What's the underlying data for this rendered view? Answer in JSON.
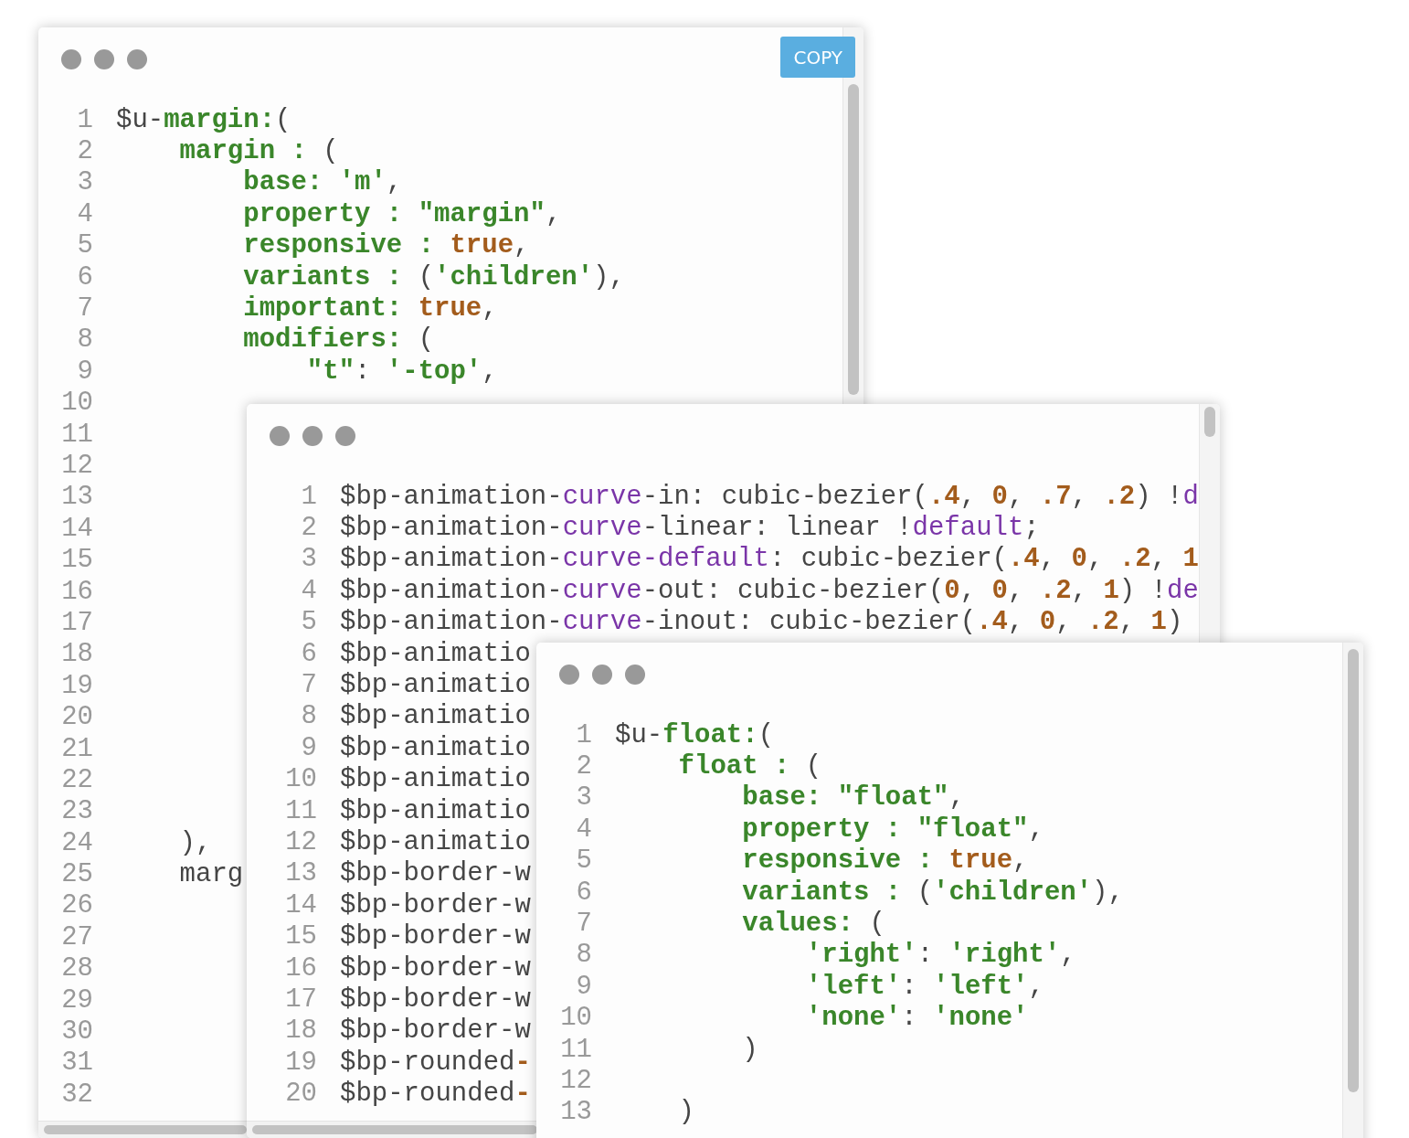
{
  "windows": [
    {
      "copy_button": "COPY",
      "lines": [
        {
          "n": "1",
          "tokens": [
            {
              "t": "$u-",
              "kind": "plain"
            },
            {
              "t": "margin:",
              "kind": "green"
            },
            {
              "t": "(",
              "kind": "plain"
            }
          ]
        },
        {
          "n": "2",
          "tokens": [
            {
              "t": "    margin :",
              "kind": "green"
            },
            {
              "t": " (",
              "kind": "plain"
            }
          ]
        },
        {
          "n": "3",
          "tokens": [
            {
              "t": "        base: 'm'",
              "kind": "green"
            },
            {
              "t": ",",
              "kind": "plain"
            }
          ]
        },
        {
          "n": "4",
          "tokens": [
            {
              "t": "        property : \"margin\"",
              "kind": "green"
            },
            {
              "t": ",",
              "kind": "plain"
            }
          ]
        },
        {
          "n": "5",
          "tokens": [
            {
              "t": "        responsive : ",
              "kind": "green"
            },
            {
              "t": "true",
              "kind": "orange"
            },
            {
              "t": ",",
              "kind": "plain"
            }
          ]
        },
        {
          "n": "6",
          "tokens": [
            {
              "t": "        variants : ",
              "kind": "green"
            },
            {
              "t": "(",
              "kind": "plain"
            },
            {
              "t": "'children'",
              "kind": "green"
            },
            {
              "t": "),",
              "kind": "plain"
            }
          ]
        },
        {
          "n": "7",
          "tokens": [
            {
              "t": "        important: ",
              "kind": "green"
            },
            {
              "t": "true",
              "kind": "orange"
            },
            {
              "t": ",",
              "kind": "plain"
            }
          ]
        },
        {
          "n": "8",
          "tokens": [
            {
              "t": "        modifiers: ",
              "kind": "green"
            },
            {
              "t": "(",
              "kind": "plain"
            }
          ]
        },
        {
          "n": "9",
          "tokens": [
            {
              "t": "            \"t\"",
              "kind": "green"
            },
            {
              "t": ": ",
              "kind": "plain"
            },
            {
              "t": "'-top'",
              "kind": "green"
            },
            {
              "t": ",",
              "kind": "plain"
            }
          ]
        },
        {
          "n": "10"
        },
        {
          "n": "11"
        },
        {
          "n": "12"
        },
        {
          "n": "13"
        },
        {
          "n": "14"
        },
        {
          "n": "15"
        },
        {
          "n": "16"
        },
        {
          "n": "17"
        },
        {
          "n": "18"
        },
        {
          "n": "19"
        },
        {
          "n": "20"
        },
        {
          "n": "21"
        },
        {
          "n": "22"
        },
        {
          "n": "23"
        },
        {
          "n": "24",
          "tokens": [
            {
              "t": "    ),",
              "kind": "plain"
            }
          ]
        },
        {
          "n": "25",
          "tokens": [
            {
              "t": "    marg",
              "kind": "plain"
            }
          ]
        },
        {
          "n": "26"
        },
        {
          "n": "27"
        },
        {
          "n": "28"
        },
        {
          "n": "29"
        },
        {
          "n": "30"
        },
        {
          "n": "31"
        },
        {
          "n": "32"
        }
      ]
    },
    {
      "lines": [
        {
          "n": "1",
          "tokens": [
            {
              "t": "$bp-animation-",
              "kind": "plain"
            },
            {
              "t": "curve",
              "kind": "purple"
            },
            {
              "t": "-in: cubic-bezier(",
              "kind": "plain"
            },
            {
              "t": ".4",
              "kind": "orange"
            },
            {
              "t": ", ",
              "kind": "plain"
            },
            {
              "t": "0",
              "kind": "orange"
            },
            {
              "t": ", ",
              "kind": "plain"
            },
            {
              "t": ".7",
              "kind": "orange"
            },
            {
              "t": ", ",
              "kind": "plain"
            },
            {
              "t": ".2",
              "kind": "orange"
            },
            {
              "t": ") !",
              "kind": "plain"
            },
            {
              "t": "d",
              "kind": "purple"
            }
          ]
        },
        {
          "n": "2",
          "tokens": [
            {
              "t": "$bp-animation-",
              "kind": "plain"
            },
            {
              "t": "curve",
              "kind": "purple"
            },
            {
              "t": "-linear: linear !",
              "kind": "plain"
            },
            {
              "t": "default",
              "kind": "purple"
            },
            {
              "t": ";",
              "kind": "plain"
            }
          ]
        },
        {
          "n": "3",
          "tokens": [
            {
              "t": "$bp-animation-",
              "kind": "plain"
            },
            {
              "t": "curve-default",
              "kind": "purple"
            },
            {
              "t": ": cubic-bezier(",
              "kind": "plain"
            },
            {
              "t": ".4",
              "kind": "orange"
            },
            {
              "t": ", ",
              "kind": "plain"
            },
            {
              "t": "0",
              "kind": "orange"
            },
            {
              "t": ", ",
              "kind": "plain"
            },
            {
              "t": ".2",
              "kind": "orange"
            },
            {
              "t": ", ",
              "kind": "plain"
            },
            {
              "t": "1",
              "kind": "orange"
            }
          ]
        },
        {
          "n": "4",
          "tokens": [
            {
              "t": "$bp-animation-",
              "kind": "plain"
            },
            {
              "t": "curve",
              "kind": "purple"
            },
            {
              "t": "-out: cubic-bezier(",
              "kind": "plain"
            },
            {
              "t": "0",
              "kind": "orange"
            },
            {
              "t": ", ",
              "kind": "plain"
            },
            {
              "t": "0",
              "kind": "orange"
            },
            {
              "t": ", ",
              "kind": "plain"
            },
            {
              "t": ".2",
              "kind": "orange"
            },
            {
              "t": ", ",
              "kind": "plain"
            },
            {
              "t": "1",
              "kind": "orange"
            },
            {
              "t": ") !",
              "kind": "plain"
            },
            {
              "t": "de",
              "kind": "purple"
            }
          ]
        },
        {
          "n": "5",
          "tokens": [
            {
              "t": "$bp-animation-",
              "kind": "plain"
            },
            {
              "t": "curve",
              "kind": "purple"
            },
            {
              "t": "-inout: cubic-bezier(",
              "kind": "plain"
            },
            {
              "t": ".4",
              "kind": "orange"
            },
            {
              "t": ", ",
              "kind": "plain"
            },
            {
              "t": "0",
              "kind": "orange"
            },
            {
              "t": ", ",
              "kind": "plain"
            },
            {
              "t": ".2",
              "kind": "orange"
            },
            {
              "t": ", ",
              "kind": "plain"
            },
            {
              "t": "1",
              "kind": "orange"
            },
            {
              "t": ")",
              "kind": "plain"
            }
          ]
        },
        {
          "n": "6",
          "tokens": [
            {
              "t": "$bp-animatio",
              "kind": "plain"
            }
          ]
        },
        {
          "n": "7",
          "tokens": [
            {
              "t": "$bp-animatio",
              "kind": "plain"
            }
          ]
        },
        {
          "n": "8",
          "tokens": [
            {
              "t": "$bp-animatio",
              "kind": "plain"
            }
          ]
        },
        {
          "n": "9",
          "tokens": [
            {
              "t": "$bp-animatio",
              "kind": "plain"
            }
          ]
        },
        {
          "n": "10",
          "tokens": [
            {
              "t": "$bp-animatio",
              "kind": "plain"
            }
          ]
        },
        {
          "n": "11",
          "tokens": [
            {
              "t": "$bp-animatio",
              "kind": "plain"
            }
          ]
        },
        {
          "n": "12",
          "tokens": [
            {
              "t": "$bp-animatio",
              "kind": "plain"
            }
          ]
        },
        {
          "n": "13",
          "tokens": [
            {
              "t": "$bp-border-w",
              "kind": "plain"
            }
          ]
        },
        {
          "n": "14",
          "tokens": [
            {
              "t": "$bp-border-w",
              "kind": "plain"
            }
          ]
        },
        {
          "n": "15",
          "tokens": [
            {
              "t": "$bp-border-w",
              "kind": "plain"
            }
          ]
        },
        {
          "n": "16",
          "tokens": [
            {
              "t": "$bp-border-w",
              "kind": "plain"
            }
          ]
        },
        {
          "n": "17",
          "tokens": [
            {
              "t": "$bp-border-w",
              "kind": "plain"
            }
          ]
        },
        {
          "n": "18",
          "tokens": [
            {
              "t": "$bp-border-w",
              "kind": "plain"
            }
          ]
        },
        {
          "n": "19",
          "tokens": [
            {
              "t": "$bp-rounded",
              "kind": "plain"
            },
            {
              "t": "-",
              "kind": "orange"
            }
          ]
        },
        {
          "n": "20",
          "tokens": [
            {
              "t": "$bp-rounded",
              "kind": "plain"
            },
            {
              "t": "-",
              "kind": "orange"
            }
          ]
        }
      ]
    },
    {
      "lines": [
        {
          "n": "1",
          "tokens": [
            {
              "t": "$u-",
              "kind": "plain"
            },
            {
              "t": "float:",
              "kind": "green"
            },
            {
              "t": "(",
              "kind": "plain"
            }
          ]
        },
        {
          "n": "2",
          "tokens": [
            {
              "t": "    float :",
              "kind": "green"
            },
            {
              "t": " (",
              "kind": "plain"
            }
          ]
        },
        {
          "n": "3",
          "tokens": [
            {
              "t": "        base: \"float\"",
              "kind": "green"
            },
            {
              "t": ",",
              "kind": "plain"
            }
          ]
        },
        {
          "n": "4",
          "tokens": [
            {
              "t": "        property : \"float\"",
              "kind": "green"
            },
            {
              "t": ",",
              "kind": "plain"
            }
          ]
        },
        {
          "n": "5",
          "tokens": [
            {
              "t": "        responsive : ",
              "kind": "green"
            },
            {
              "t": "true",
              "kind": "orange"
            },
            {
              "t": ",",
              "kind": "plain"
            }
          ]
        },
        {
          "n": "6",
          "tokens": [
            {
              "t": "        variants : ",
              "kind": "green"
            },
            {
              "t": "(",
              "kind": "plain"
            },
            {
              "t": "'children'",
              "kind": "green"
            },
            {
              "t": "),",
              "kind": "plain"
            }
          ]
        },
        {
          "n": "7",
          "tokens": [
            {
              "t": "        values: ",
              "kind": "green"
            },
            {
              "t": "(",
              "kind": "plain"
            }
          ]
        },
        {
          "n": "8",
          "tokens": [
            {
              "t": "            'right'",
              "kind": "green"
            },
            {
              "t": ": ",
              "kind": "plain"
            },
            {
              "t": "'right'",
              "kind": "green"
            },
            {
              "t": ",",
              "kind": "plain"
            }
          ]
        },
        {
          "n": "9",
          "tokens": [
            {
              "t": "            'left'",
              "kind": "green"
            },
            {
              "t": ": ",
              "kind": "plain"
            },
            {
              "t": "'left'",
              "kind": "green"
            },
            {
              "t": ",",
              "kind": "plain"
            }
          ]
        },
        {
          "n": "10",
          "tokens": [
            {
              "t": "            'none'",
              "kind": "green"
            },
            {
              "t": ": ",
              "kind": "plain"
            },
            {
              "t": "'none'",
              "kind": "green"
            }
          ]
        },
        {
          "n": "11",
          "tokens": [
            {
              "t": "        )",
              "kind": "plain"
            }
          ]
        },
        {
          "n": "12"
        },
        {
          "n": "13",
          "tokens": [
            {
              "t": "    )",
              "kind": "plain"
            }
          ]
        }
      ]
    }
  ]
}
